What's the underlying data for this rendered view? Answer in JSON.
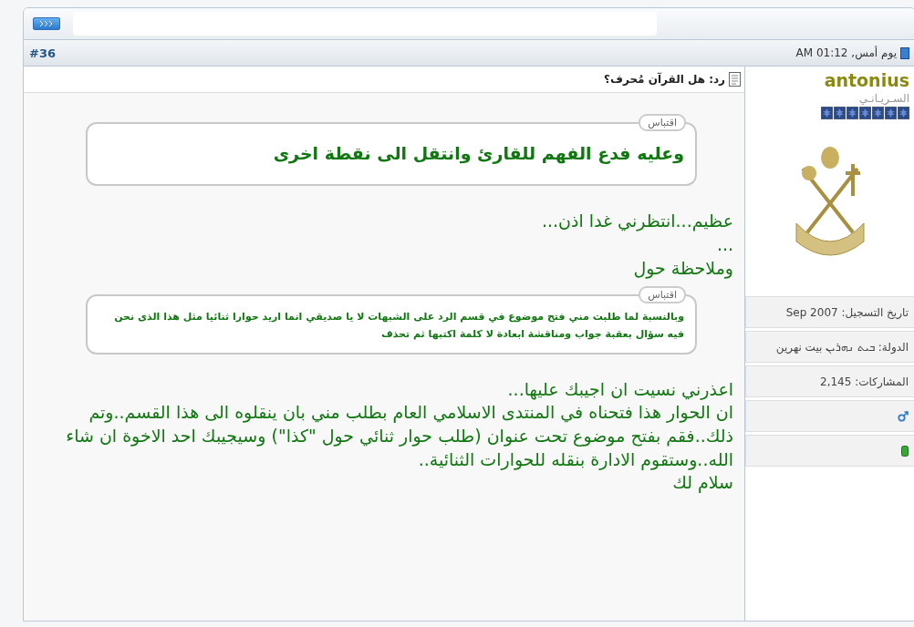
{
  "post": {
    "date": "يوم أمس, 01:12 AM",
    "number": "#36",
    "title": "رد: هل القرآن مُحرف؟"
  },
  "user": {
    "name": "antonius",
    "rank": "السـريـانـي",
    "stars": 7,
    "fields": [
      {
        "kind": "text",
        "text": "تاريخ التسجيل: Sep 2007"
      },
      {
        "kind": "text",
        "text": "الدولة: ܒܝܬ ܢܗܪܝܢ بيت نهرين"
      },
      {
        "kind": "text",
        "text": "المشاركات: 2,145"
      },
      {
        "kind": "gender"
      },
      {
        "kind": "status",
        "online": true
      }
    ]
  },
  "body": [
    {
      "kind": "quote_large",
      "label": "اقتباس",
      "text": "وعليه فدع الفهم للقارئ وانتقل الى نقطة اخرى"
    },
    {
      "kind": "lines",
      "lines": [
        "عظيم...انتظرني غدا اذن...",
        "...",
        "وملاحظة حول"
      ]
    },
    {
      "kind": "quote_small",
      "label": "اقتباس",
      "text": "وبالنسبة لما طلبت مني فتح موضوع في قسم الرد على الشبهات لا يا صديقي انما اريد حوارا ثنائيا مثل هذا الذى نحن فيه سؤال بعقبة جواب ومناقشة ابعادة لا كلمة اكتبها ثم تحذف"
    },
    {
      "kind": "lines",
      "lines": [
        "اعذرني نسيت ان اجيبك عليها...",
        "ان الحوار هذا فتحناه في المنتدى الاسلامي العام بطلب مني بان ينقلوه الى هذا القسم..وتم ذلك..فقم بفتح موضوع تحت عنوان (طلب حوار ثنائي حول \"كذا\") وسيجيبك احد الاخوة ان شاء الله..وستقوم الادارة بنقله للحوارات الثنائية..",
        "سلام لك"
      ]
    }
  ]
}
